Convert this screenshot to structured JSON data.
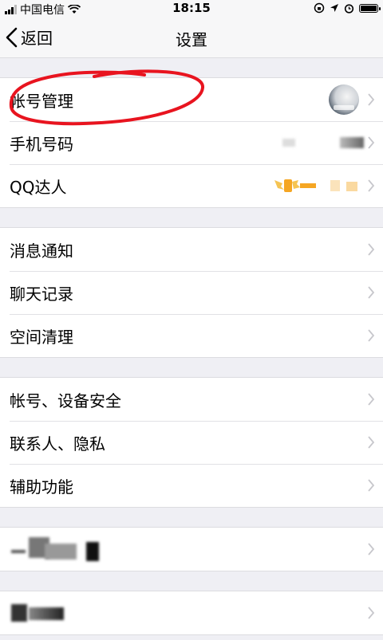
{
  "status_bar": {
    "carrier": "中国电信",
    "time": "18:15"
  },
  "nav": {
    "back_label": "返回",
    "title": "设置"
  },
  "groups": [
    [
      {
        "id": "account",
        "label": "帐号管理"
      },
      {
        "id": "phone",
        "label": "手机号码"
      },
      {
        "id": "qq-daren",
        "label": "QQ达人"
      }
    ],
    [
      {
        "id": "notify",
        "label": "消息通知"
      },
      {
        "id": "chat-history",
        "label": "聊天记录"
      },
      {
        "id": "space-clean",
        "label": "空间清理"
      }
    ],
    [
      {
        "id": "security",
        "label": "帐号、设备安全"
      },
      {
        "id": "privacy",
        "label": "联系人、隐私"
      },
      {
        "id": "accessibility",
        "label": "辅助功能"
      }
    ]
  ],
  "colors": {
    "background": "#efeff4",
    "annotation_red": "#e8141f",
    "badge_gold": "#f5a623"
  }
}
